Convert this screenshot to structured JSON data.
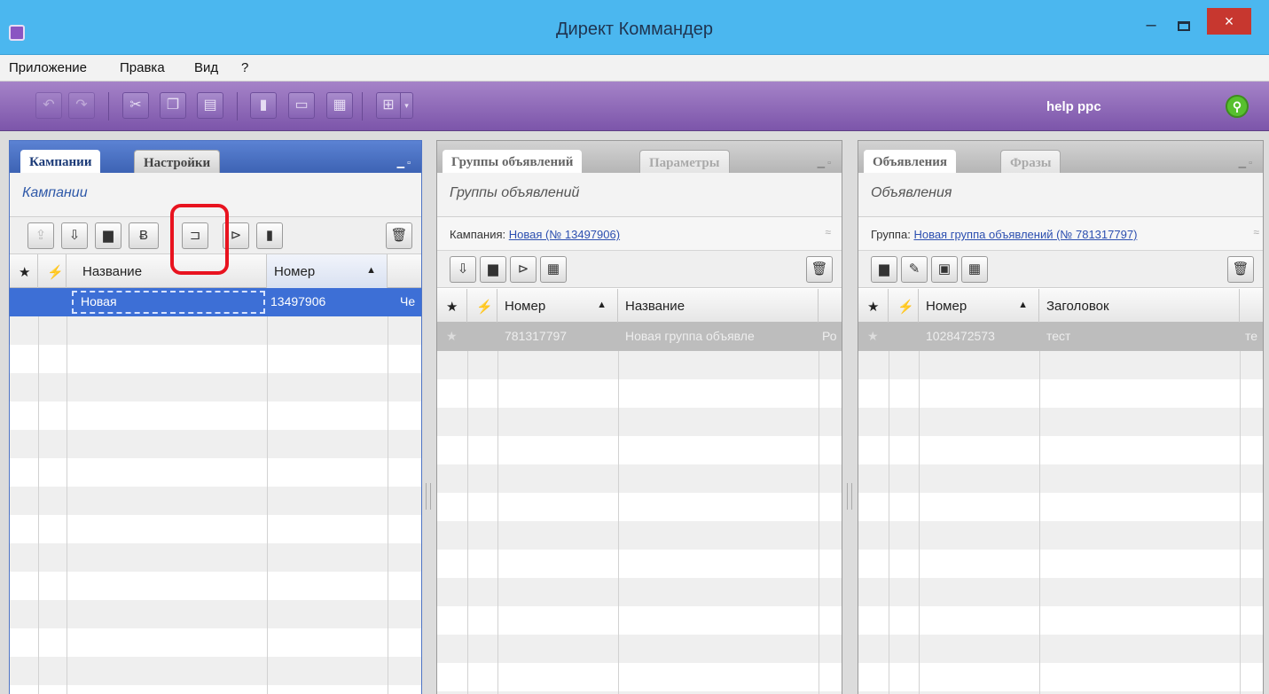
{
  "window": {
    "title": "Директ Коммандер",
    "close_glyph": "×",
    "min_glyph": "–"
  },
  "menu": [
    "Приложение",
    "Правка",
    "Вид",
    "?"
  ],
  "toolbar": {
    "user_label": "help ppc"
  },
  "left_panel": {
    "tabs": [
      "Кампании",
      "Настройки"
    ],
    "subtitle": "Кампании",
    "columns": [
      "Название",
      "Номер"
    ],
    "rows": [
      {
        "name": "Новая",
        "number": "13497906",
        "extra": "Че"
      }
    ]
  },
  "middle_panel": {
    "tabs": [
      "Группы объявлений",
      "Параметры"
    ],
    "subtitle": "Группы объявлений",
    "context_label": "Кампания:",
    "context_link": "Новая (№ 13497906)",
    "columns": [
      "Номер",
      "Название"
    ],
    "rows": [
      {
        "number": "781317797",
        "name": "Новая группа объявле",
        "extra": "Ро"
      }
    ]
  },
  "right_panel": {
    "tabs": [
      "Объявления",
      "Фразы"
    ],
    "subtitle": "Объявления",
    "context_label": "Группа:",
    "context_link": "Новая группа объявлений (№ 781317797)",
    "columns": [
      "Номер",
      "Заголовок"
    ],
    "rows": [
      {
        "number": "1028472573",
        "title": "тест",
        "extra": "те"
      }
    ]
  },
  "icons": {
    "star": "★",
    "flag": "⚡",
    "sort_asc": "▲",
    "trash": "🗑",
    "expand": "≈"
  }
}
